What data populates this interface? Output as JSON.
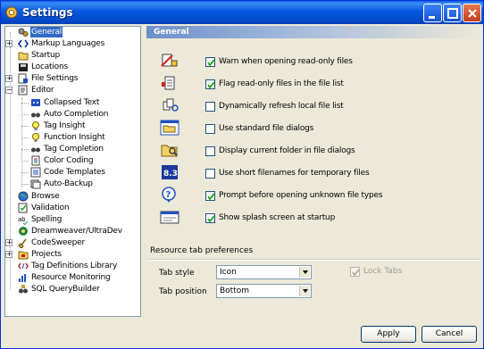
{
  "window": {
    "title": "Settings"
  },
  "tree": {
    "items": [
      {
        "label": "General",
        "icon": "gears-icon",
        "selected": true
      },
      {
        "label": "Markup Languages",
        "icon": "code-brackets-icon"
      },
      {
        "label": "Startup",
        "icon": "open-folder-icon"
      },
      {
        "label": "Locations",
        "icon": "disk-icon"
      },
      {
        "label": "File Settings",
        "icon": "file-settings-icon"
      },
      {
        "label": "Editor",
        "icon": "editor-icon"
      },
      {
        "label": "Collapsed Text",
        "icon": "collapse-icon"
      },
      {
        "label": "Auto Completion",
        "icon": "binoculars-icon"
      },
      {
        "label": "Tag Insight",
        "icon": "lightbulb-icon"
      },
      {
        "label": "Function Insight",
        "icon": "lightbulb-icon"
      },
      {
        "label": "Tag Completion",
        "icon": "binoculars-icon"
      },
      {
        "label": "Color Coding",
        "icon": "document-icon"
      },
      {
        "label": "Code Templates",
        "icon": "code-template-icon"
      },
      {
        "label": "Auto-Backup",
        "icon": "backup-icon"
      },
      {
        "label": "Browse",
        "icon": "globe-icon"
      },
      {
        "label": "Validation",
        "icon": "validation-icon"
      },
      {
        "label": "Spelling",
        "icon": "spelling-icon"
      },
      {
        "label": "Dreamweaver/UltraDev",
        "icon": "dreamweaver-icon"
      },
      {
        "label": "CodeSweeper",
        "icon": "sweeper-icon"
      },
      {
        "label": "Projects",
        "icon": "projects-icon"
      },
      {
        "label": "Tag Definitions Library",
        "icon": "tag-library-icon"
      },
      {
        "label": "Resource Monitoring",
        "icon": "monitor-icon"
      },
      {
        "label": "SQL QueryBuilder",
        "icon": "sql-builder-icon"
      }
    ]
  },
  "panel": {
    "header": "General",
    "options": [
      {
        "label": "Warn when opening read-only files",
        "checked": true,
        "icon": "read-only-warning-icon"
      },
      {
        "label": "Flag read-only files in the file list",
        "checked": true,
        "icon": "flag-file-icon"
      },
      {
        "label": "Dynamically refresh local file list",
        "checked": false,
        "icon": "refresh-files-icon"
      },
      {
        "label": "Use standard file dialogs",
        "checked": false,
        "icon": "file-dialog-icon"
      },
      {
        "label": "Display current folder in file dialogs",
        "checked": false,
        "icon": "current-folder-icon"
      },
      {
        "label": "Use short filenames for temporary files",
        "checked": false,
        "icon": "short-filename-icon",
        "icon_text": "8.3"
      },
      {
        "label": "Prompt before opening unknown file types",
        "checked": true,
        "icon": "unknown-type-icon"
      },
      {
        "label": "Show splash screen at startup",
        "checked": true,
        "icon": "splash-screen-icon"
      }
    ],
    "resource_group": {
      "title": "Resource tab preferences",
      "tab_style_label": "Tab style",
      "tab_style_value": "Icon",
      "tab_position_label": "Tab position",
      "tab_position_value": "Bottom",
      "lock_tabs_label": "Lock Tabs",
      "lock_tabs_checked": true,
      "lock_tabs_enabled": false
    }
  },
  "buttons": {
    "apply": "Apply",
    "cancel": "Cancel"
  }
}
